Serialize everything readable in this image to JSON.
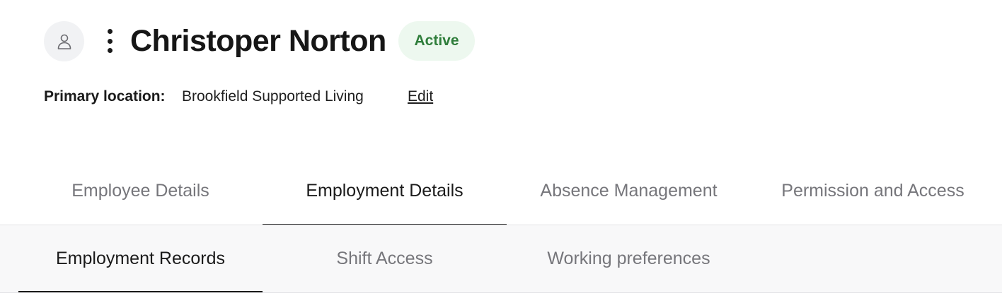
{
  "header": {
    "name": "Christoper Norton",
    "status": "Active",
    "avatar_icon": "user-icon",
    "menu_icon": "kebab-menu-icon",
    "status_color": "#2e7d3a",
    "status_bg": "#edf8ef"
  },
  "location": {
    "label": "Primary location:",
    "value": "Brookfield Supported Living",
    "edit_label": "Edit"
  },
  "tabs": [
    {
      "label": "Employee Details",
      "active": false
    },
    {
      "label": "Employment Details",
      "active": true
    },
    {
      "label": "Absence Management",
      "active": false
    },
    {
      "label": "Permission and Access",
      "active": false
    }
  ],
  "subtabs": [
    {
      "label": "Employment Records",
      "active": true
    },
    {
      "label": "Shift Access",
      "active": false
    },
    {
      "label": "Working preferences",
      "active": false
    }
  ]
}
